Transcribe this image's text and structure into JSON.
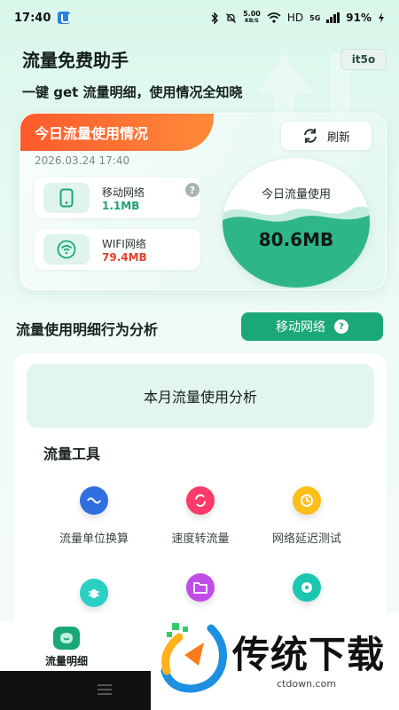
{
  "status_bar": {
    "time": "17:40",
    "speed_top": "5.00",
    "speed_unit": "KB/S",
    "hd": "HD",
    "network": "5G",
    "battery": "91%"
  },
  "header": {
    "title": "流量免费助手",
    "brand_chip": "it5o",
    "subtitle": "一键 get 流量明细，使用情况全知晓"
  },
  "today": {
    "tag": "今日流量使用情况",
    "refresh_label": "刷新",
    "date": "2026.03.24 17:40",
    "mobile": {
      "name": "移动网络",
      "value": "1.1MB",
      "help": "?"
    },
    "wifi": {
      "name": "WIFI网络",
      "value": "79.4MB"
    },
    "gauge": {
      "label": "今日流量使用",
      "value": "80.6MB"
    }
  },
  "section": {
    "title": "流量使用明细行为分析",
    "network_select": "移动网络",
    "network_help": "?"
  },
  "month_analysis": "本月流量使用分析",
  "tools": {
    "title": "流量工具",
    "items": [
      {
        "label": "流量单位换算",
        "icon": "unit-convert-icon",
        "color": "#2f6fe0"
      },
      {
        "label": "速度转流量",
        "icon": "speed-convert-icon",
        "color": "#ff3b6a"
      },
      {
        "label": "网络延迟测试",
        "icon": "latency-test-icon",
        "color": "#ffbf1a"
      },
      {
        "label": "",
        "icon": "bug-icon",
        "color": "#2ad0c4"
      },
      {
        "label": "",
        "icon": "folder-icon",
        "color": "#c04de8"
      },
      {
        "label": "",
        "icon": "disc-icon",
        "color": "#1bc7b1"
      }
    ]
  },
  "bottom_nav": {
    "label": "流量明细"
  },
  "watermark": {
    "text": "传统下载",
    "url": "ctdown.com"
  }
}
